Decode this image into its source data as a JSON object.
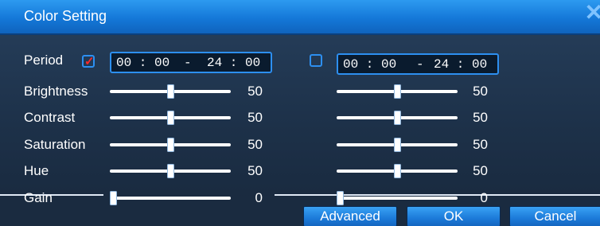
{
  "window": {
    "title": "Color Setting",
    "close_icon": "close-icon"
  },
  "period": {
    "label": "Period",
    "left": {
      "checked": true,
      "start": "00 : 00",
      "separator": "-",
      "end": "24 : 00"
    },
    "right": {
      "checked": false,
      "start": "00 : 00",
      "separator": "-",
      "end": "24 : 00"
    }
  },
  "sliders": [
    {
      "label": "Brightness",
      "left_value": "50",
      "right_value": "50",
      "left_level": 0.5,
      "right_level": 0.5
    },
    {
      "label": "Contrast",
      "left_value": "50",
      "right_value": "50",
      "left_level": 0.5,
      "right_level": 0.5
    },
    {
      "label": "Saturation",
      "left_value": "50",
      "right_value": "50",
      "left_level": 0.5,
      "right_level": 0.5
    },
    {
      "label": "Hue",
      "left_value": "50",
      "right_value": "50",
      "left_level": 0.5,
      "right_level": 0.5
    },
    {
      "label": "Gain",
      "left_value": "0",
      "right_value": "0",
      "left_level": 0.0,
      "right_level": 0.0
    }
  ],
  "buttons": {
    "advanced": "Advanced",
    "ok": "OK",
    "cancel": "Cancel"
  },
  "colors": {
    "title_bar": "#1478d8",
    "accent": "#2d8ff0",
    "check_mark": "#ff2a2a",
    "background": "#1d3149"
  }
}
